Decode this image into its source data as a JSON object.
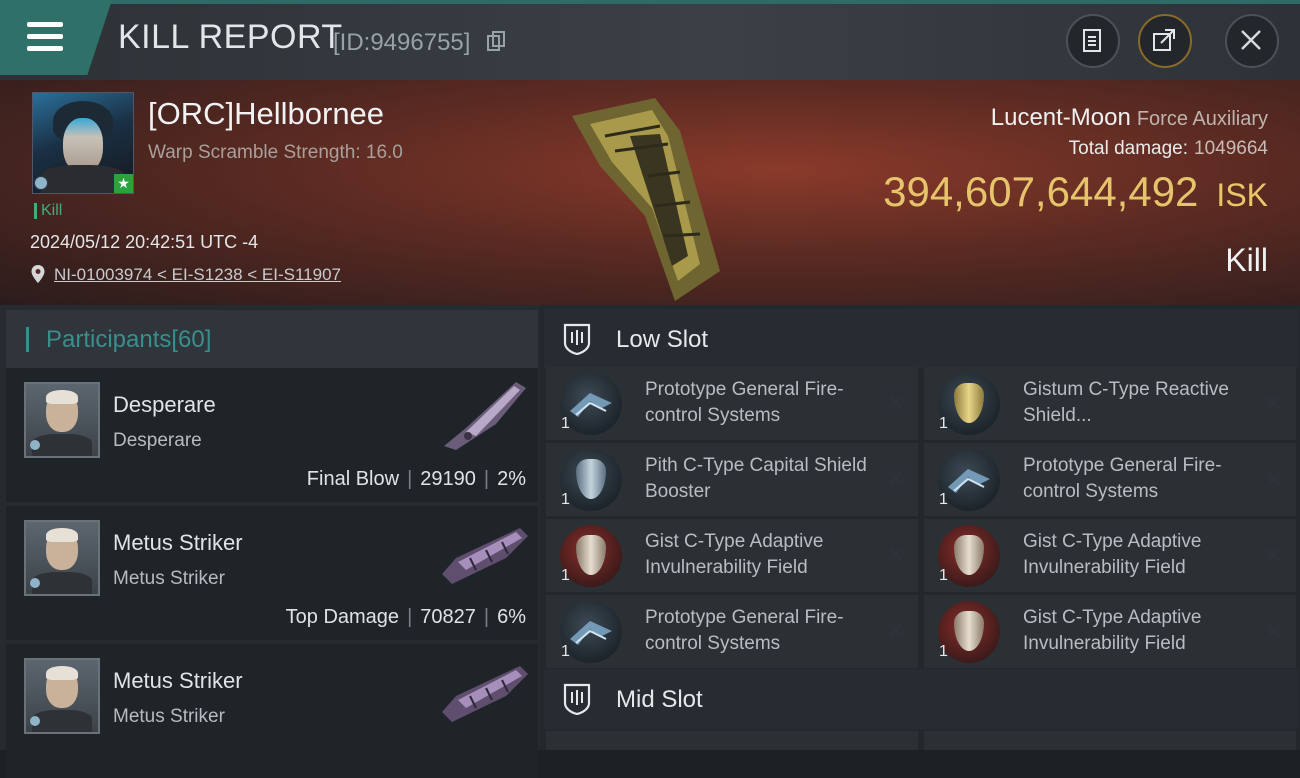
{
  "header": {
    "title": "KILL REPORT",
    "kill_id": "[ID:9496755]"
  },
  "victim": {
    "pilot": "[ORC]Hellbornee",
    "scramble": "Warp Scramble Strength: 16.0",
    "tag": "Kill",
    "timestamp": "2024/05/12 20:42:51 UTC -4",
    "location": "NI-01003974 < EI-S1238 < EI-S11907",
    "ship_name": "Lucent-Moon",
    "ship_class": "Force Auxiliary",
    "total_damage_label": "Total damage:",
    "total_damage": "1049664",
    "isk_value": "394,607,644,492",
    "isk_unit": "ISK",
    "kill_type": "Kill"
  },
  "participants": {
    "label": "Participants",
    "count": "[60]",
    "rows": [
      {
        "name": "Desperare",
        "corp": "Desperare",
        "stat_label": "Final Blow",
        "damage": "29190",
        "percent": "2%"
      },
      {
        "name": "Metus Striker",
        "corp": "Metus Striker",
        "stat_label": "Top Damage",
        "damage": "70827",
        "percent": "6%"
      },
      {
        "name": "Metus Striker",
        "corp": "Metus Striker",
        "stat_label": "",
        "damage": "",
        "percent": ""
      }
    ]
  },
  "fitting": {
    "low_slot_label": "Low Slot",
    "mid_slot_label": "Mid Slot",
    "low_slot": [
      {
        "name": "Prototype General Fire-control Systems",
        "qty": "1",
        "icon": "fire-control-icon"
      },
      {
        "name": "Gistum C-Type Reactive Shield...",
        "qty": "1",
        "icon": "gold-shield-icon"
      },
      {
        "name": "Pith C-Type Capital Shield Booster",
        "qty": "1",
        "icon": "shield-booster-icon"
      },
      {
        "name": "Prototype General Fire-control Systems",
        "qty": "1",
        "icon": "fire-control-icon"
      },
      {
        "name": "Gist C-Type Adaptive Invulnerability Field",
        "qty": "1",
        "icon": "red-shield-icon"
      },
      {
        "name": "Gist C-Type Adaptive Invulnerability Field",
        "qty": "1",
        "icon": "red-shield-icon"
      },
      {
        "name": "Prototype General Fire-control Systems",
        "qty": "1",
        "icon": "fire-control-icon"
      },
      {
        "name": "Gist C-Type Adaptive Invulnerability Field",
        "qty": "1",
        "icon": "red-shield-icon"
      }
    ]
  },
  "colors": {
    "accent_teal": "#2f7069",
    "isk_gold": "#e6c46b",
    "kill_green": "#3fae7a"
  }
}
